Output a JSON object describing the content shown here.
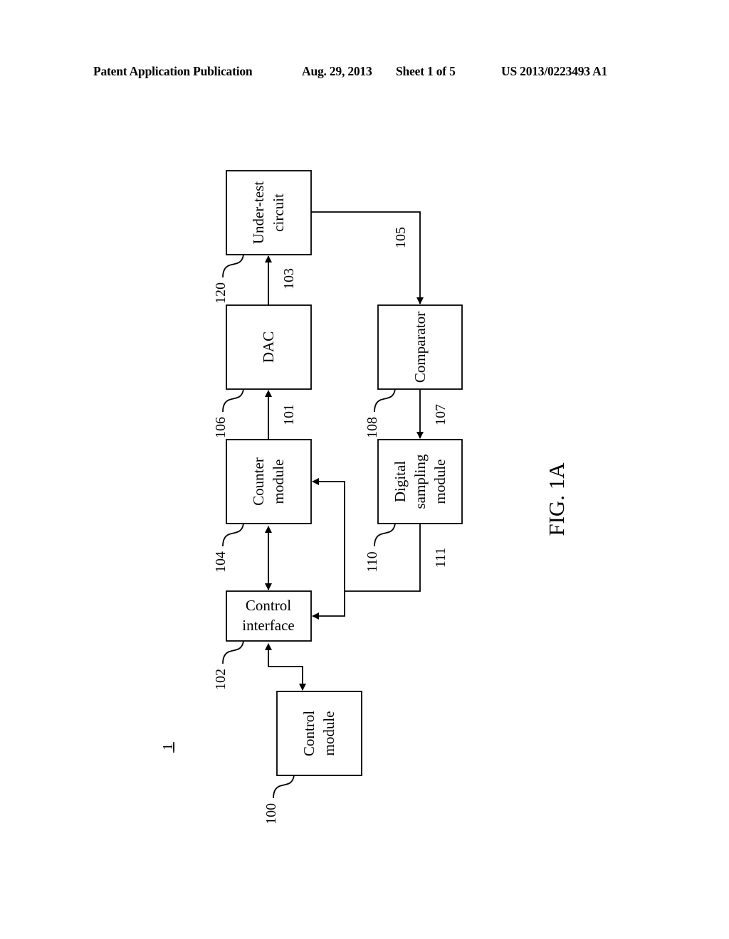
{
  "header": {
    "left": "Patent Application Publication",
    "date": "Aug. 29, 2013",
    "sheet": "Sheet 1 of 5",
    "number": "US 2013/0223493 A1"
  },
  "figure": {
    "caption": "FIG. 1A",
    "system_ref": "1",
    "blocks": {
      "under_test": {
        "ref": "120",
        "lines": [
          "Under-test",
          "circuit"
        ]
      },
      "dac": {
        "ref": "106",
        "lines": [
          "DAC"
        ]
      },
      "counter": {
        "ref": "104",
        "lines": [
          "Counter",
          "module"
        ]
      },
      "control_interface": {
        "ref": "102",
        "lines": [
          "Control",
          "interface"
        ]
      },
      "control_module": {
        "ref": "100",
        "lines": [
          "Control",
          "module"
        ]
      },
      "comparator": {
        "ref": "108",
        "lines": [
          "Comparator"
        ]
      },
      "digital_sampling": {
        "ref": "110",
        "lines": [
          "Digital",
          "sampling",
          "module"
        ]
      }
    },
    "signals": {
      "s101": "101",
      "s103": "103",
      "s105": "105",
      "s107": "107",
      "s111": "111"
    }
  }
}
